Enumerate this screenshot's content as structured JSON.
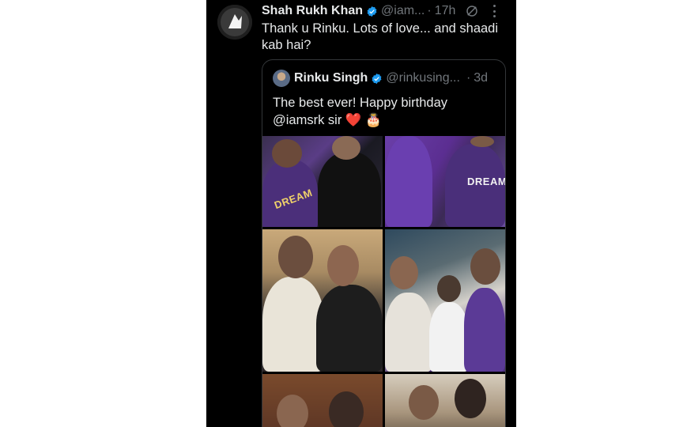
{
  "tweet": {
    "author_name": "Shah Rukh Khan",
    "author_handle": "@iam...",
    "separator": "·",
    "time": "17h",
    "text": "Thank u Rinku. Lots of love... and shaadi kab hai?",
    "icons": [
      "grok-icon",
      "more-icon",
      "verified-badge-icon"
    ]
  },
  "quoted_tweet": {
    "author_name": "Rinku Singh",
    "author_handle": "@rinkusing...",
    "separator": "·",
    "time": "3d",
    "text": "The best ever! Happy birthday @iamsrk sir",
    "emoji": [
      "❤️",
      "🎂"
    ],
    "media": {
      "count": 6,
      "jersey_labels": [
        "DREAM",
        "DREAM"
      ]
    }
  },
  "colors": {
    "background": "#000000",
    "text_primary": "#e7e9ea",
    "text_secondary": "#71767b",
    "verified_blue": "#1d9bf0",
    "border": "#333639"
  }
}
